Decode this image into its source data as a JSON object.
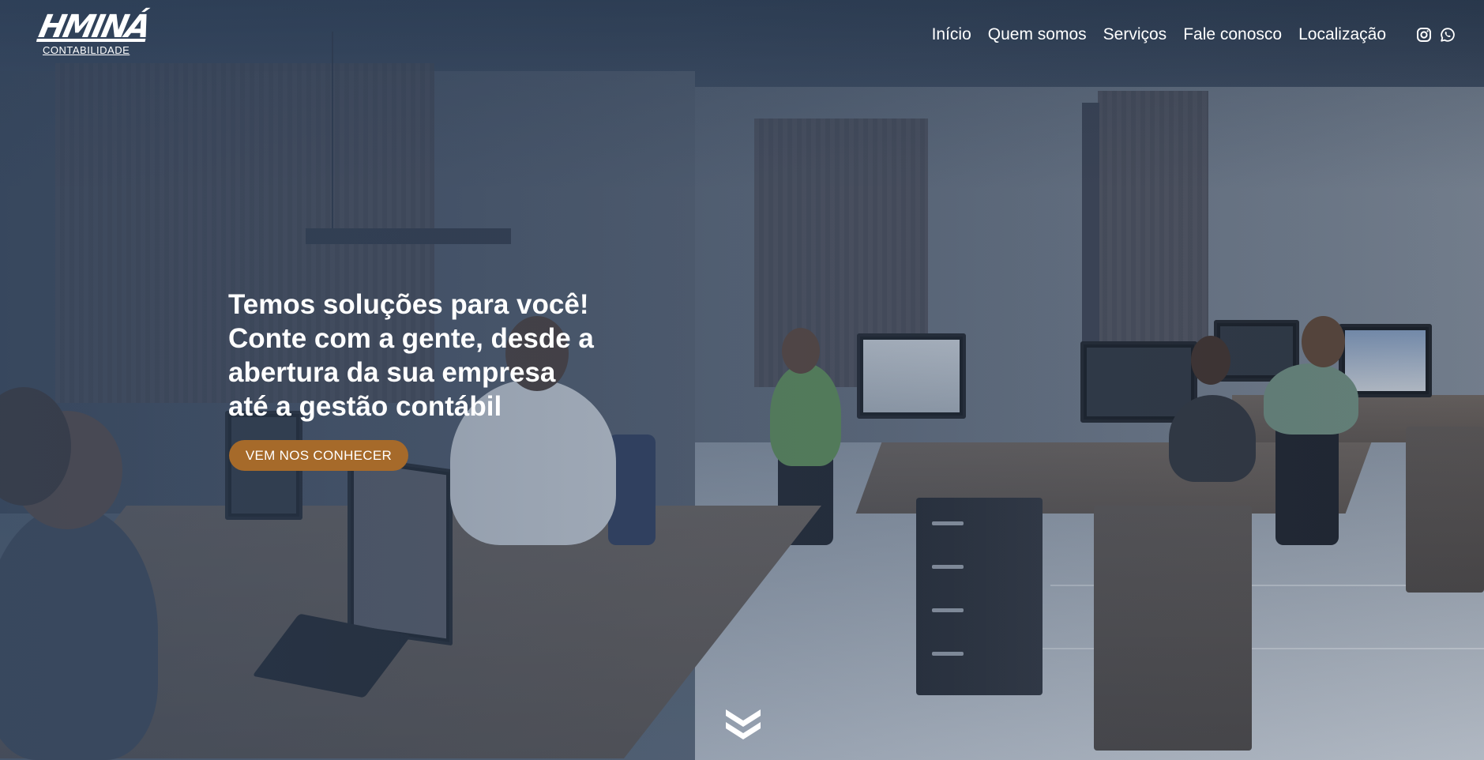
{
  "brand": {
    "logo_mark": "HMINÁ",
    "logo_subtitle": "CONTABILIDADE"
  },
  "nav": {
    "items": [
      {
        "label": "Início"
      },
      {
        "label": "Quem somos"
      },
      {
        "label": "Serviços"
      },
      {
        "label": "Fale conosco"
      },
      {
        "label": "Localização"
      }
    ]
  },
  "social": {
    "icons": [
      "instagram-icon",
      "whatsapp-icon"
    ]
  },
  "hero": {
    "title": "Temos soluções para você!\nConte com a gente, desde a\nabertura da sua empresa\naté a gestão contábil",
    "cta_label": "VEM NOS CONHECER",
    "cta_color": "#a66a2a"
  },
  "scroll": {
    "icon": "double-chevron-down-icon"
  }
}
